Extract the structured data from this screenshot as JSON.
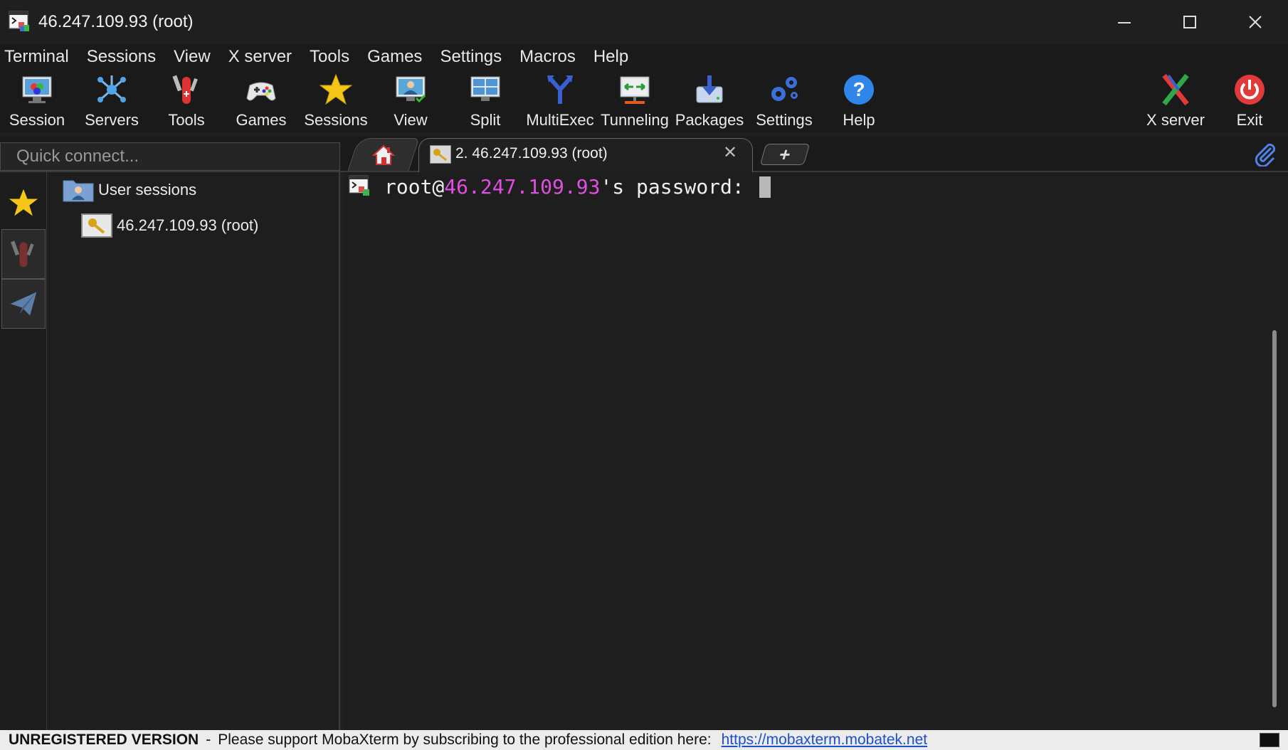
{
  "window": {
    "title": "46.247.109.93 (root)",
    "minimize": "—",
    "maximize": "☐",
    "close": "✕"
  },
  "menu": [
    "Terminal",
    "Sessions",
    "View",
    "X server",
    "Tools",
    "Games",
    "Settings",
    "Macros",
    "Help"
  ],
  "toolbar": {
    "items": [
      "Session",
      "Servers",
      "Tools",
      "Games",
      "Sessions",
      "View",
      "Split",
      "MultiExec",
      "Tunneling",
      "Packages",
      "Settings",
      "Help"
    ],
    "right_items": [
      "X server",
      "Exit"
    ]
  },
  "quick_connect": {
    "placeholder": "Quick connect..."
  },
  "tabs": {
    "active_title": "2. 46.247.109.93 (root)",
    "close": "✕",
    "new_tab": "+"
  },
  "sidebar": {
    "folder_label": "User sessions",
    "session_label": "46.247.109.93 (root)"
  },
  "terminal": {
    "prefix": "root@",
    "host": "46.247.109.93",
    "suffix": "'s password: "
  },
  "status": {
    "unregistered": "UNREGISTERED VERSION",
    "separator": "-",
    "message": "Please support MobaXterm by subscribing to the professional edition here:",
    "link": "https://mobaxterm.mobatek.net"
  },
  "colors": {
    "ip_highlight": "#e04ee0",
    "link": "#1a4fd1"
  }
}
